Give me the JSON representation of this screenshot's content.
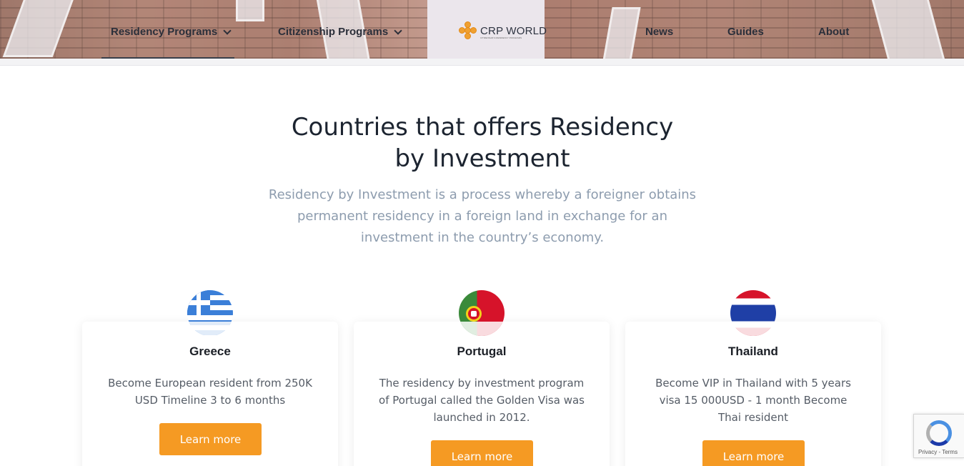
{
  "nav": {
    "left": [
      {
        "label": "Residency Programs",
        "has_dropdown": true
      },
      {
        "label": "Citizenship Programs",
        "has_dropdown": true
      }
    ],
    "right": [
      {
        "label": "News"
      },
      {
        "label": "Guides"
      },
      {
        "label": "About"
      }
    ],
    "logo_text": "CRP WORLD",
    "logo_subtext": "CITIZENSHIP & RESIDENCY PROGRAMS"
  },
  "hero": {
    "title_line1": "Countries that offers Residency",
    "title_line2": "by Investment",
    "subtitle": "Residency by Investment is a process whereby a foreigner obtains permanent residency in a foreign land in exchange for an investment in the country’s economy."
  },
  "cards": [
    {
      "country": "Greece",
      "flag": "greece-flag",
      "description": "Become European resident from 250K USD Timeline 3 to 6 months",
      "button": "Learn more"
    },
    {
      "country": "Portugal",
      "flag": "portugal-flag",
      "description": "The residency by investment program of Portugal called the Golden Visa was launched in 2012.",
      "button": "Learn more"
    },
    {
      "country": "Thailand",
      "flag": "thailand-flag",
      "description": "Become VIP in Thailand with 5 years visa 15 000USD - 1 month Become Thai resident",
      "button": "Learn more"
    }
  ],
  "recaptcha": {
    "text": "Privacy - Terms"
  },
  "colors": {
    "accent": "#f59a23",
    "heading": "#1c2430",
    "subtext": "#8d9cae"
  }
}
